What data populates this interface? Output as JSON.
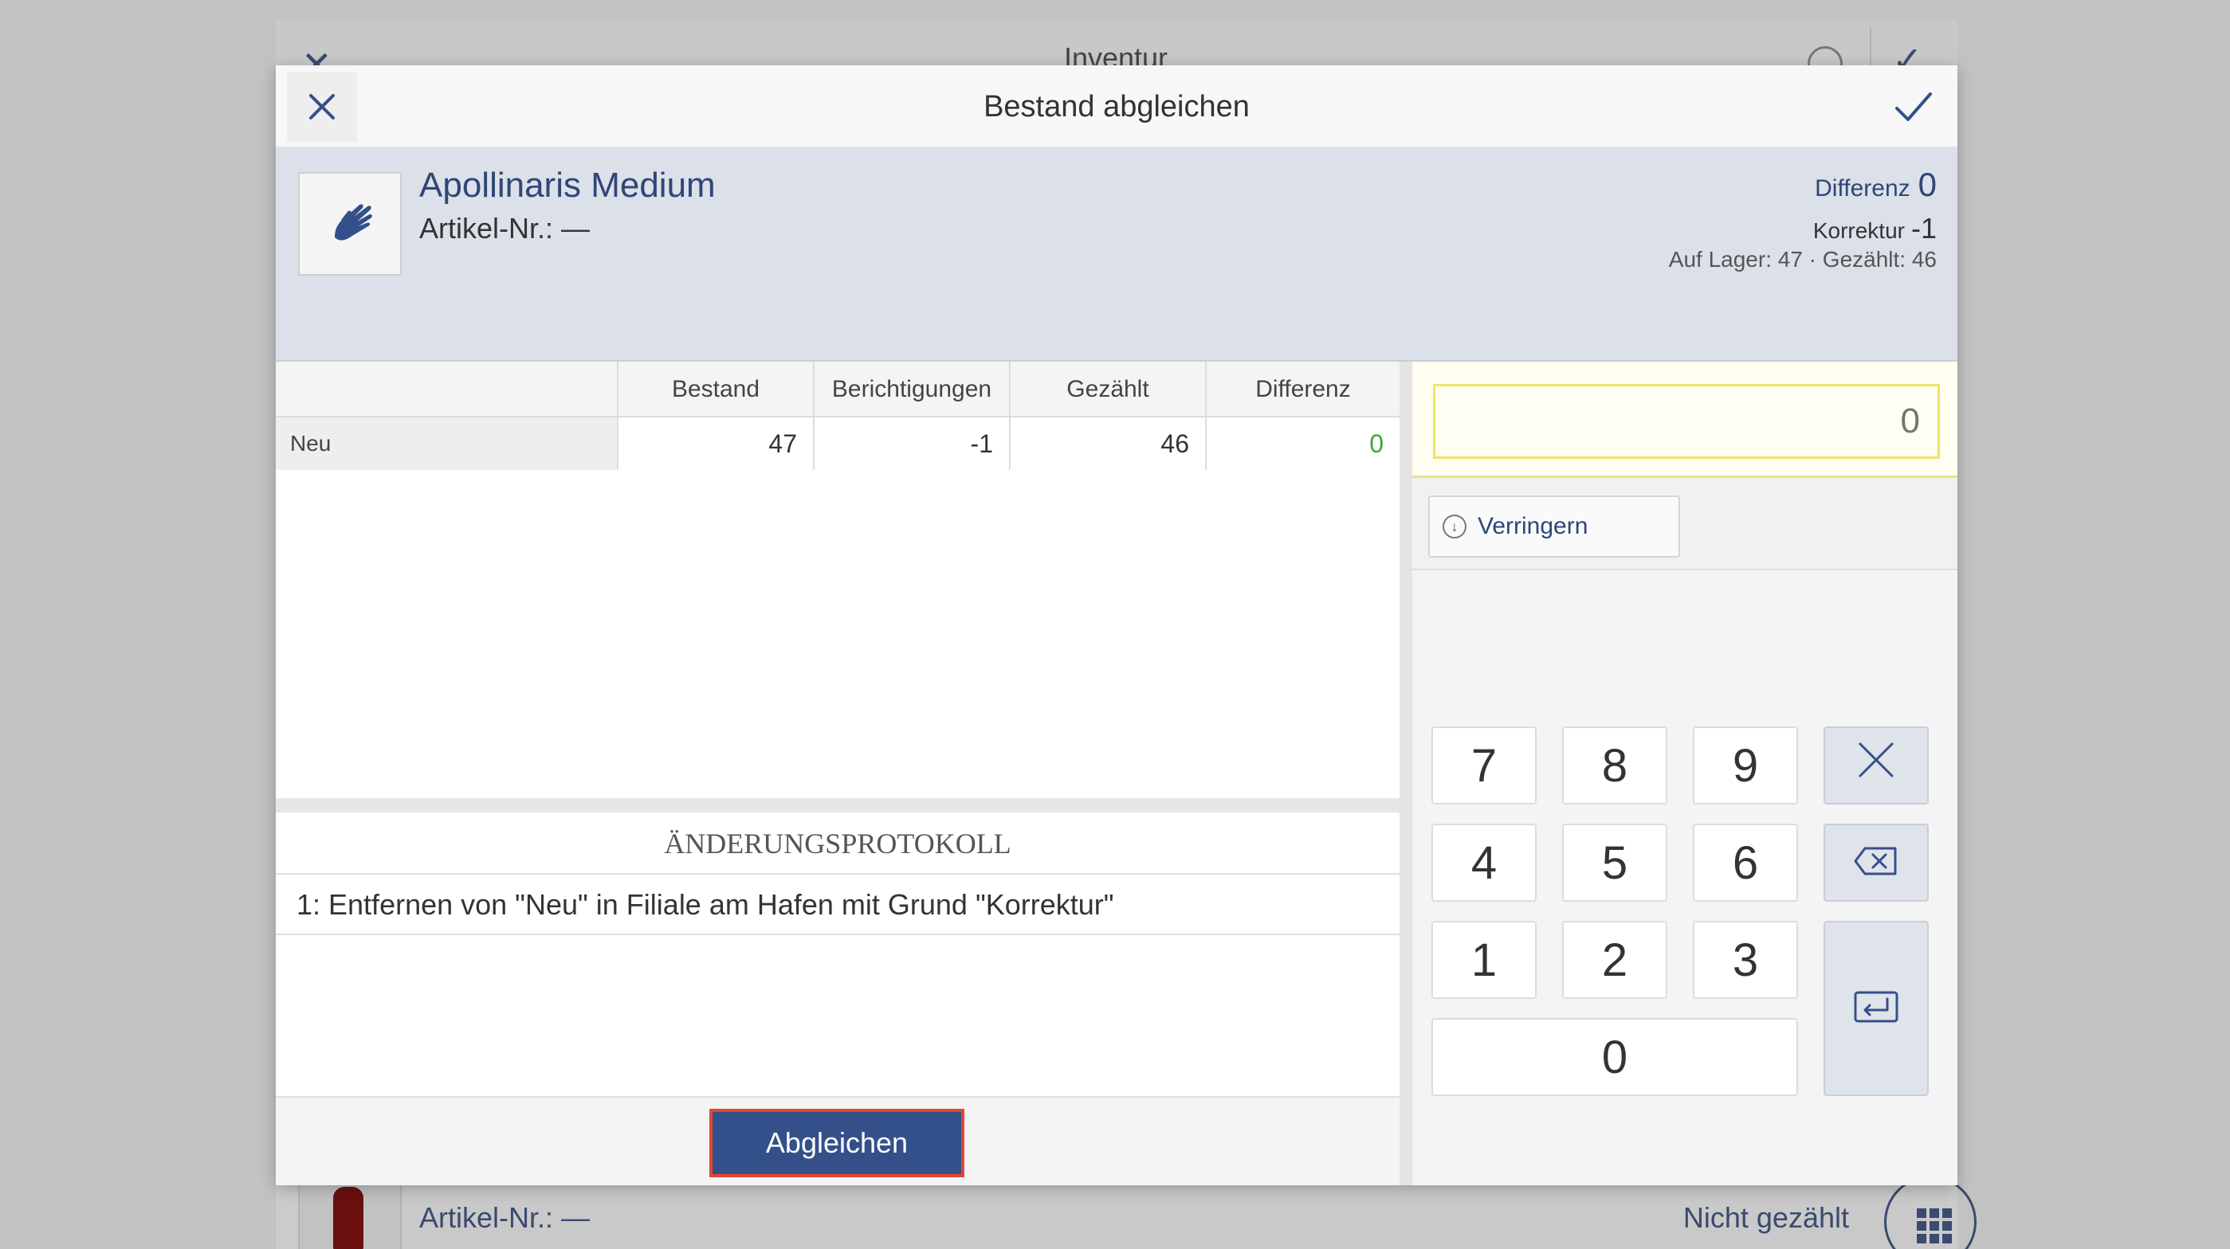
{
  "background": {
    "title": "Inventur",
    "row_article": "Artikel-Nr.: —",
    "row_status": "Nicht gezählt"
  },
  "modal": {
    "title": "Bestand abgleichen",
    "product": {
      "name": "Apollinaris Medium",
      "article": "Artikel-Nr.: —",
      "differenz_label": "Differenz",
      "differenz_value": "0",
      "korrektur_label": "Korrektur",
      "korrektur_value": "-1",
      "lager_text": "Auf Lager: 47 · Gezählt: 46"
    },
    "table": {
      "headers": [
        "Bestand",
        "Berichtigungen",
        "Gezählt",
        "Differenz"
      ],
      "rows": [
        {
          "label": "Neu",
          "bestand": "47",
          "berichtigungen": "-1",
          "gezaehlt": "46",
          "differenz": "0"
        }
      ]
    },
    "log": {
      "title": "ÄNDERUNGSPROTOKOLL",
      "entries": [
        "1: Entfernen von \"Neu\" in Filiale am Hafen mit Grund \"Korrektur\""
      ]
    },
    "primary_button": "Abgleichen",
    "input": {
      "placeholder": "0"
    },
    "decrease_button": "Verringern",
    "keypad": [
      "7",
      "8",
      "9",
      "4",
      "5",
      "6",
      "1",
      "2",
      "3",
      "0"
    ]
  },
  "colors": {
    "accent": "#34508a",
    "positive": "#3aa83a",
    "highlight": "#e2472e"
  }
}
